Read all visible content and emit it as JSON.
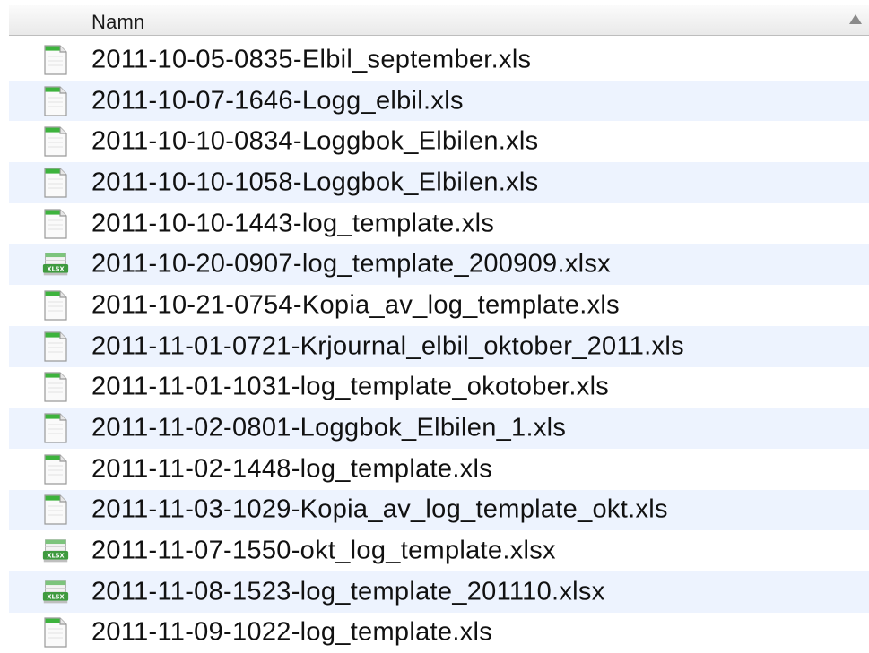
{
  "header": {
    "column_label": "Namn",
    "sort_icon": "sort-ascending-arrow-icon"
  },
  "files": [
    {
      "name": "2011-10-05-0835-Elbil_september.xls",
      "icon": "xls-file-icon"
    },
    {
      "name": "2011-10-07-1646-Logg_elbil.xls",
      "icon": "xls-file-icon"
    },
    {
      "name": "2011-10-10-0834-Loggbok_Elbilen.xls",
      "icon": "xls-file-icon"
    },
    {
      "name": "2011-10-10-1058-Loggbok_Elbilen.xls",
      "icon": "xls-file-icon"
    },
    {
      "name": "2011-10-10-1443-log_template.xls",
      "icon": "xls-file-icon"
    },
    {
      "name": "2011-10-20-0907-log_template_200909.xlsx",
      "icon": "xlsx-file-icon"
    },
    {
      "name": "2011-10-21-0754-Kopia_av_log_template.xls",
      "icon": "xls-file-icon"
    },
    {
      "name": "2011-11-01-0721-Krjournal_elbil_oktober_2011.xls",
      "icon": "xls-file-icon"
    },
    {
      "name": "2011-11-01-1031-log_template_okotober.xls",
      "icon": "xls-file-icon"
    },
    {
      "name": "2011-11-02-0801-Loggbok_Elbilen_1.xls",
      "icon": "xls-file-icon"
    },
    {
      "name": "2011-11-02-1448-log_template.xls",
      "icon": "xls-file-icon"
    },
    {
      "name": "2011-11-03-1029-Kopia_av_log_template_okt.xls",
      "icon": "xls-file-icon"
    },
    {
      "name": "2011-11-07-1550-okt_log_template.xlsx",
      "icon": "xlsx-file-icon"
    },
    {
      "name": "2011-11-08-1523-log_template_201110.xlsx",
      "icon": "xlsx-file-icon"
    },
    {
      "name": "2011-11-09-1022-log_template.xls",
      "icon": "xls-file-icon"
    }
  ],
  "colors": {
    "alt_row": "#edf3fe",
    "icon_green": "#3db33d",
    "text": "#111111"
  }
}
